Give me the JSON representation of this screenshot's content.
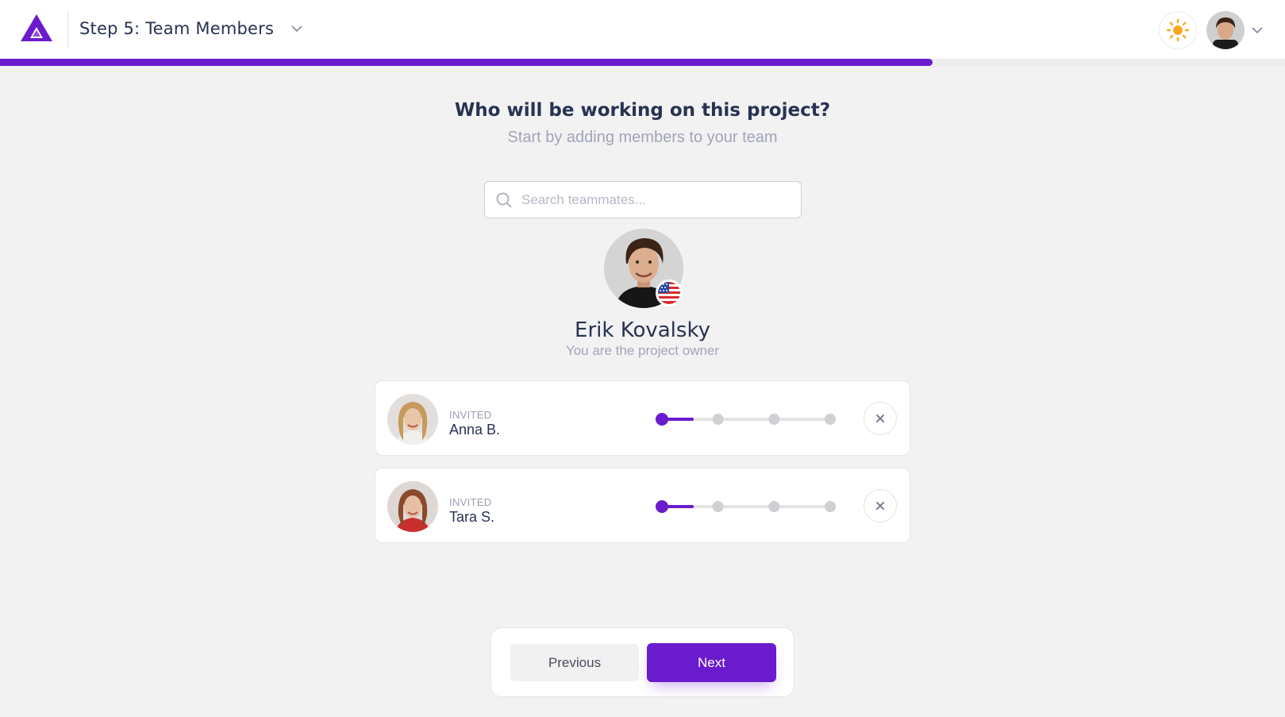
{
  "header": {
    "step_title": "Step 5: Team Members",
    "progress_fraction": 0.726
  },
  "main": {
    "heading": "Who will be working on this project?",
    "subheading": "Start by adding members to your team"
  },
  "search": {
    "placeholder": "Search teammates..."
  },
  "owner": {
    "name": "Erik Kovalsky",
    "role": "You are the project owner",
    "flag": "us-flag-icon"
  },
  "members": [
    {
      "status": "INVITED",
      "name": "Anna B.",
      "level": 1,
      "levels": 4
    },
    {
      "status": "INVITED",
      "name": "Tara S.",
      "level": 1,
      "levels": 4
    }
  ],
  "nav": {
    "previous_label": "Previous",
    "next_label": "Next"
  },
  "colors": {
    "accent": "#6a1bce",
    "sun": "#f9a825"
  }
}
